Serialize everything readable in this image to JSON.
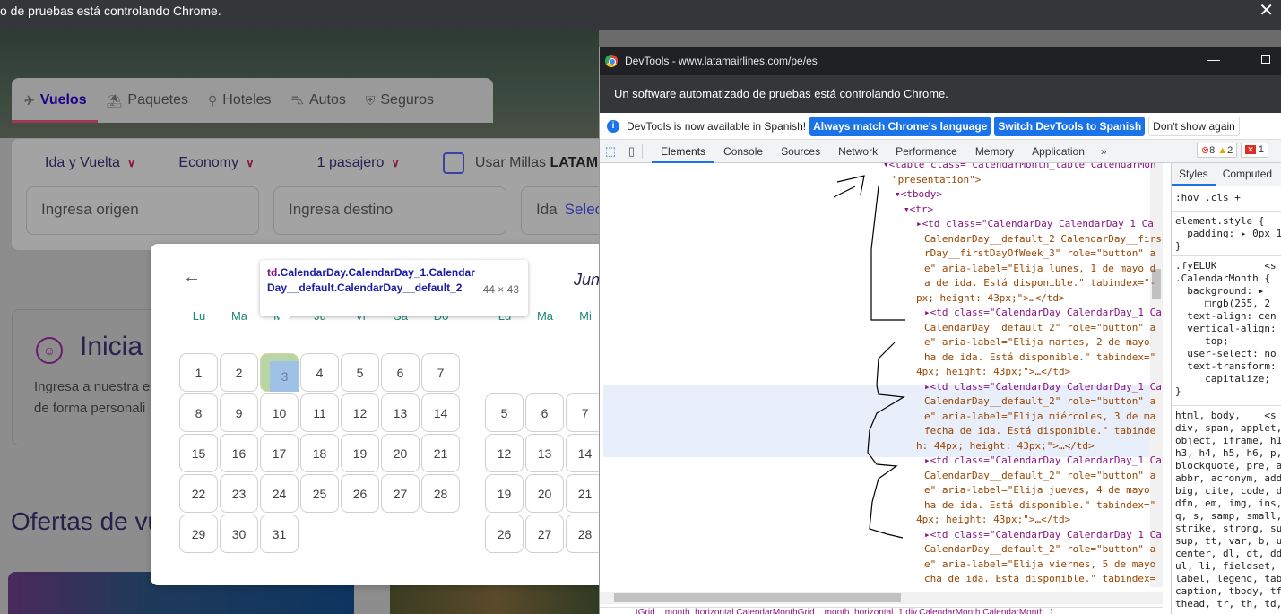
{
  "browser": {
    "automation_banner": "o de pruebas está controlando Chrome.",
    "close_label": "✕"
  },
  "page": {
    "tabs": [
      {
        "label": "Vuelos",
        "icon": "plane-icon",
        "glyph": "✈",
        "active": true
      },
      {
        "label": "Paquetes",
        "icon": "package-icon",
        "glyph": "⛱",
        "active": false
      },
      {
        "label": "Hoteles",
        "icon": "hotel-icon",
        "glyph": "⚲",
        "active": false
      },
      {
        "label": "Autos",
        "icon": "car-icon",
        "glyph": "⛍",
        "active": false
      },
      {
        "label": "Seguros",
        "icon": "shield-icon",
        "glyph": "⛨",
        "active": false
      }
    ],
    "search": {
      "trip_type": "Ida y Vuelta",
      "cabin": "Economy",
      "passengers": "1 pasajero",
      "chevron": "∨",
      "use_miles_label": "Usar Millas",
      "use_miles_brand": "LATAM",
      "origin_placeholder": "Ingresa origen",
      "destination_placeholder": "Ingresa destino",
      "departure_label": "Ida",
      "departure_value": "Selec"
    },
    "login_card": {
      "title": "Inicia s",
      "desc_line1": "Ingresa a nuestra e",
      "desc_line2": "de forma personali"
    },
    "offers_title": "Ofertas de vu"
  },
  "calendar": {
    "prev_arrow": "←",
    "next_month_label": "Jun",
    "weekdays": [
      "Lu",
      "Ma",
      "Mi",
      "Ju",
      "Vi",
      "Sa",
      "Do"
    ],
    "weekdays_right": [
      "Lu",
      "Ma",
      "Mi"
    ],
    "month1_days": [
      "1",
      "2",
      "3",
      "4",
      "5",
      "6",
      "7",
      "8",
      "9",
      "10",
      "11",
      "12",
      "13",
      "14",
      "15",
      "16",
      "17",
      "18",
      "19",
      "20",
      "21",
      "22",
      "23",
      "24",
      "25",
      "26",
      "27",
      "28",
      "29",
      "30",
      "31"
    ],
    "month2_rows": [
      [
        "5",
        "6",
        "7"
      ],
      [
        "12",
        "13",
        "14"
      ],
      [
        "19",
        "20",
        "21"
      ],
      [
        "26",
        "27",
        "28"
      ]
    ],
    "highlighted_day": "3"
  },
  "inspect_tooltip": {
    "tag": "td",
    "classes": ".CalendarDay.CalendarDay_1.CalendarDay__default.CalendarDay__default_2",
    "size": "44 × 43"
  },
  "devtools": {
    "title": "DevTools - www.latamairlines.com/pe/es",
    "min_label": "—",
    "automation_banner": "Un software automatizado de pruebas está controlando Chrome.",
    "lang_notice": "DevTools is now available in Spanish!",
    "btn_match": "Always match Chrome's language",
    "btn_switch": "Switch DevTools to Spanish",
    "btn_dismiss": "Don't show again",
    "tabs": [
      "Elements",
      "Console",
      "Sources",
      "Network",
      "Performance",
      "Memory",
      "Application"
    ],
    "more_tabs": "»",
    "errors": "8",
    "warnings": "2",
    "issues": "1",
    "dom_lines": [
      "▾<table class=\"CalendarMonth_table CalendarMon",
      "\"presentation\">",
      "▾<tbody>",
      "▾<tr>",
      "▸<td class=\"CalendarDay CalendarDay_1 Ca",
      "CalendarDay__default_2 CalendarDay__firs",
      "rDay__firstDayOfWeek_3\" role=\"button\" a",
      "e\" aria-label=\"Elija lunes, 1 de mayo d",
      "a de ida. Está disponible.\" tabindex=\"-",
      "px; height: 43px;\">…</td>",
      "▸<td class=\"CalendarDay CalendarDay_1 Ca",
      "CalendarDay__default_2\" role=\"button\" a",
      "e\" aria-label=\"Elija martes, 2 de mayo",
      "ha de ida. Está disponible.\" tabindex=\"",
      "4px; height: 43px;\">…</td>",
      "▸<td class=\"CalendarDay CalendarDay_1 Ca",
      "CalendarDay__default_2\" role=\"button\" a",
      "e\" aria-label=\"Elija miércoles, 3 de ma",
      "fecha de ida. Está disponible.\" tabinde",
      "h: 44px; height: 43px;\">…</td>",
      "▸<td class=\"CalendarDay CalendarDay_1 Ca",
      "CalendarDay__default_2\" role=\"button\" a",
      "e\" aria-label=\"Elija jueves, 4 de mayo",
      "ha de ida. Está disponible.\" tabindex=\"",
      "4px; height: 43px;\">…</td>",
      "▸<td class=\"CalendarDay CalendarDay_1 Ca",
      "CalendarDay__default_2\" role=\"button\" a",
      "e\" aria-label=\"Elija viernes, 5 de mayo",
      "cha de ida. Está disponible.\" tabindex="
    ],
    "breadcrumbs": "…tGrid__month_horizontal.CalendarMonthGrid__month_horizontal_1   div.CalendarMonth.CalendarMonth_1",
    "styles_tabs": [
      "Styles",
      "Computed"
    ],
    "styles_filter": ":hov  .cls  +",
    "style_blocks": [
      "element.style {\n  padding: ▸ 0px 1\n}",
      ".fyELUK        <s\n.CalendarMonth {\n  background: ▸\n     □rgb(255, 2\n  text-align: cen\n  vertical-align:\n     top;\n  user-select: no\n  text-transform:\n     capitalize;\n}",
      "html, body,    <s\ndiv, span, applet,\nobject, iframe, h1\nh3, h4, h5, h6, p,\nblockquote, pre, a\nabbr, acronym, add\nbig, cite, code, d\ndfn, em, img, ins,\nq, s, samp, small,\nstrike, strong, su\nsup, tt, var, b, u\ncenter, dl, dt, dd\nul, li, fieldset,\nlabel, legend, tab\ncaption, tbody, tf\nthead, tr, th, td,"
    ]
  }
}
